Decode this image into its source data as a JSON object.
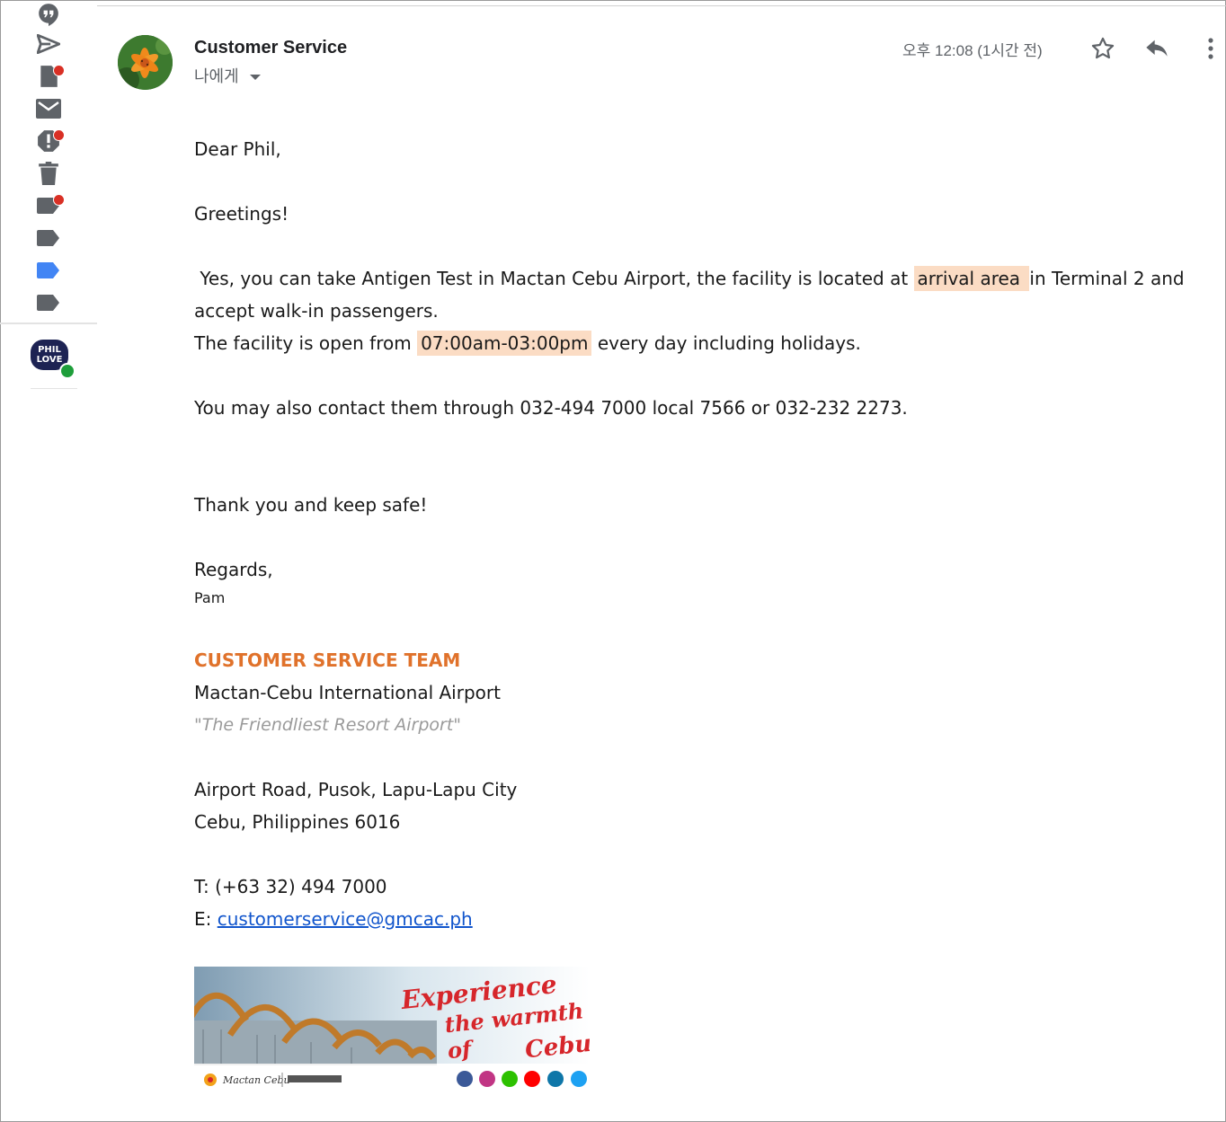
{
  "rail": {
    "icons": [
      "chat-icon",
      "sent-icon",
      "drafts-icon",
      "mail-icon",
      "spam-icon",
      "trash-icon",
      "label-icon",
      "label-icon",
      "label-icon",
      "label-icon"
    ],
    "label_colors": [
      "#5f6368",
      "#5f6368",
      "#4285f4",
      "#5f6368"
    ],
    "contact_badge": "PHIL LOVE"
  },
  "email": {
    "sender": "Customer Service",
    "to": "나에게",
    "time": "오후 12:08 (1시간 전)"
  },
  "body": {
    "greeting": "Dear Phil,",
    "greetings": "Greetings!",
    "p1_before": " Yes, you can take Antigen Test in Mactan Cebu Airport, the facility is located at ",
    "p1_highlight": "arrival area ",
    "p1_after": "in Terminal 2 and accept walk-in passengers.",
    "p2_before": "The facility is open from ",
    "p2_highlight": "07:00am-03:00pm",
    "p2_after": " every day including holidays.",
    "contact": "You may also contact them through 032-494 7000 local 7566 or 032-232 2273.",
    "thanks": "Thank you and keep safe!",
    "regards": "Regards,",
    "name": "Pam"
  },
  "signature": {
    "team": "CUSTOMER SERVICE TEAM",
    "org": "Mactan-Cebu International Airport",
    "tagline": "\"The Friendliest Resort Airport\"",
    "address1": "Airport Road, Pusok, Lapu-Lapu City",
    "address2": "Cebu, Philippines 6016",
    "phone": "T: (+63 32) 494 7000",
    "email_prefix": "E: ",
    "email": "customerservice@gmcac.ph"
  },
  "banner": {
    "line1": "Experience",
    "line2": "the warmth of",
    "line3": "Cebu!",
    "social_icons": [
      "facebook-icon",
      "instagram-icon",
      "wechat-icon",
      "youtube-icon",
      "linkedin-icon",
      "twitter-icon"
    ],
    "social_colors": [
      "#3b5998",
      "#c13584",
      "#2dc100",
      "#ff0000",
      "#0e76a8",
      "#1da1f2"
    ]
  },
  "colors": {
    "highlight": "#fbdcc4",
    "team_orange": "#e0722b",
    "link": "#1155cc"
  }
}
